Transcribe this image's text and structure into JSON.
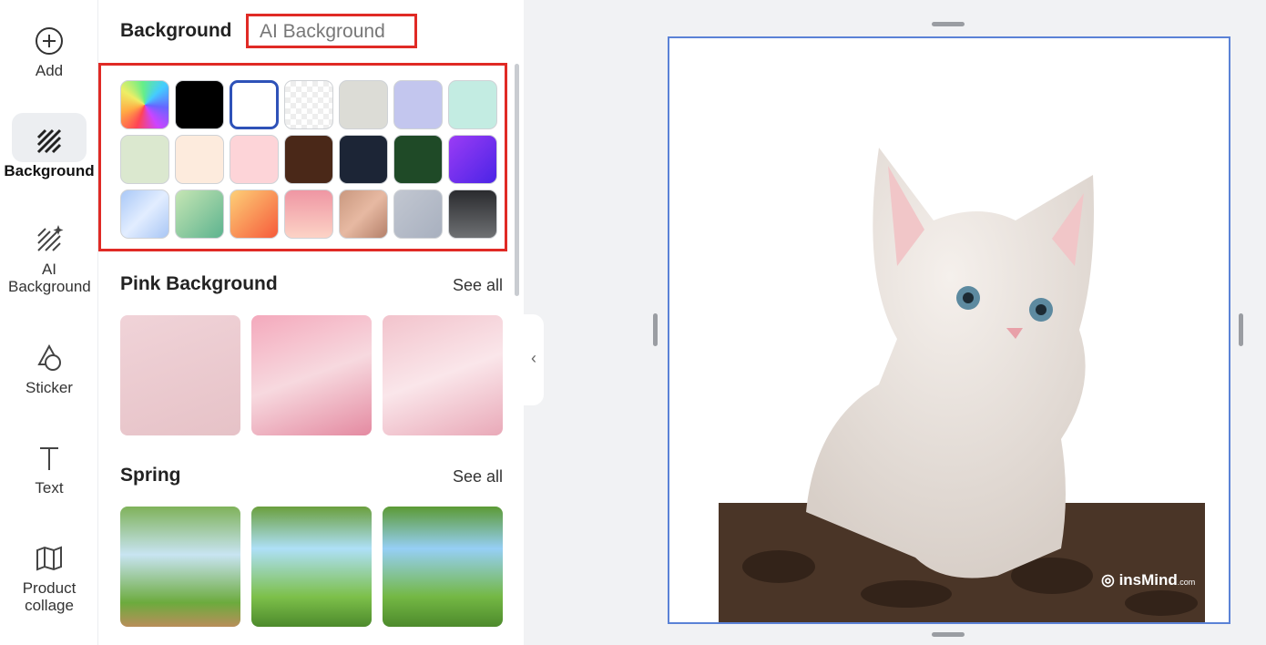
{
  "rail": {
    "items": [
      {
        "label": "Add",
        "icon": "plus-circle-icon"
      },
      {
        "label": "Background",
        "icon": "hatch-icon",
        "active": true
      },
      {
        "label": "AI Background",
        "icon": "ai-hatch-icon"
      },
      {
        "label": "Sticker",
        "icon": "sticker-icon"
      },
      {
        "label": "Text",
        "icon": "text-icon"
      },
      {
        "label": "Product collage",
        "icon": "map-icon"
      }
    ]
  },
  "panel": {
    "tabs": [
      "Background",
      "AI Background"
    ],
    "swatches": [
      "conic-gradient(from 200deg,#f45,#fa4,#ee6,#6e8,#4cf,#66f,#c4f,#f45)",
      "#000000",
      "#ffffff",
      "checker",
      "#dcdcd6",
      "#c3c6ee",
      "#c3ece2",
      "#dbe8cf",
      "#fdebdd",
      "#fdd4d8",
      "#4a2818",
      "#1c2536",
      "#1f4a27",
      "linear-gradient(135deg,#9b3cf5,#4a24e6)",
      "linear-gradient(135deg,#a9c8f7,#e2edff,#a8c6f5)",
      "linear-gradient(135deg,#c6e6b4,#5db38f)",
      "linear-gradient(135deg,#fdd078,#f65a3a)",
      "linear-gradient(180deg,#ef96a3,#fcd3c6)",
      "linear-gradient(135deg,#c9987f,#e7b9a2,#b4806a)",
      "linear-gradient(135deg,#c2c7d1,#a8b0bf)",
      "linear-gradient(180deg,#2a2b2e,#6e7073)"
    ],
    "selected_swatch": 2,
    "sections": [
      {
        "title": "Pink Background",
        "see_all": "See all",
        "thumbs": [
          "linear-gradient(160deg,#f0d3d8,#e6c2c7)",
          "linear-gradient(160deg,#f4a9bc,#f7d9df,#e48aa1)",
          "linear-gradient(160deg,#f2c3cc,#fae6ea,#e9a9b8)"
        ]
      },
      {
        "title": "Spring",
        "see_all": "See all",
        "thumbs": [
          "linear-gradient(180deg,#7fb25a,#c8e4f2 40%,#6cab3d 80%,#b98e5a)",
          "linear-gradient(180deg,#6a9f3d,#aee0f7 35%,#7dc04a 75%,#4d8a2c)",
          "linear-gradient(180deg,#5b9a34,#96cff5 35%,#74b844 75%,#4d8a2c)"
        ]
      }
    ]
  },
  "canvas": {
    "watermark": "insMind",
    "watermark_suffix": ".com",
    "accent": "#5b82d6"
  }
}
